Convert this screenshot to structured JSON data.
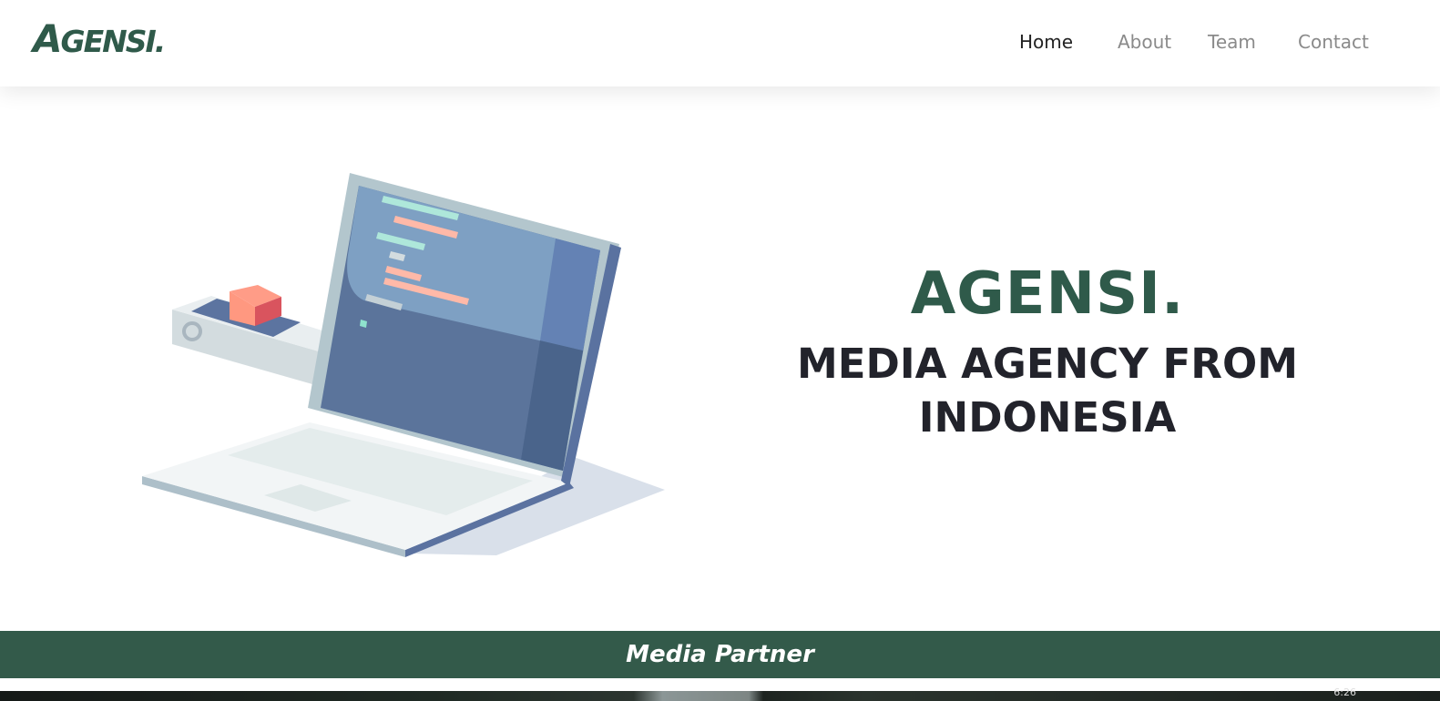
{
  "navbar": {
    "logo": {
      "first": "A",
      "rest": "GENSI."
    },
    "items": [
      {
        "label": "Home",
        "active": true
      },
      {
        "label": "About",
        "active": false
      },
      {
        "label": "Team",
        "active": false
      },
      {
        "label": "Contact",
        "active": false
      }
    ]
  },
  "hero": {
    "brand": "AGENSI.",
    "tagline": "MEDIA AGENCY FROM INDONESIA",
    "illustration_icon": "laptop-code-illustration"
  },
  "partner": {
    "title": "Media Partner"
  },
  "taskbar": {
    "clock": "6:26"
  },
  "colors": {
    "brand_green": "#2f5a4a",
    "bar_green": "#335a4a",
    "nav_inactive": "#8a8a8a",
    "nav_active": "#222222",
    "headline": "#22232b"
  }
}
